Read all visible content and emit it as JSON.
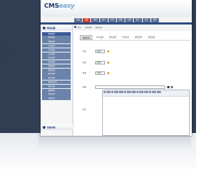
{
  "brand": {
    "name_part1": "CMS",
    "name_part2": "easy",
    "tagline": ""
  },
  "header": {
    "right_text": ""
  },
  "top_nav": {
    "tabs": [
      "首页",
      "设置",
      "内容",
      "用户",
      "订单",
      "模板",
      "功能",
      "推广",
      "日志",
      "插件"
    ],
    "active_index": 1
  },
  "sub_nav": {
    "items": [
      "首页",
      "文章管理",
      "添加内容"
    ]
  },
  "sidebar": {
    "header": "网站设置",
    "items": [
      "网站设置",
      "附件设置",
      "模板设置",
      "分类设置",
      "栏目设置",
      "安全设置",
      "会员设置",
      "邮件设置",
      "数据设置",
      "模板设置",
      "缓存管理",
      "附件管理",
      "数据库设置",
      "图片处理",
      "数据备份",
      "附件设置",
      "系统信息"
    ],
    "active_index": 0,
    "footer": "系统内容"
  },
  "main": {
    "tabs": [
      "基本信息",
      "SEO设置",
      "属性设置",
      "扩展信息",
      "模板选择",
      "高级设置"
    ],
    "active_tab": 0,
    "fields": [
      {
        "label": "栏目",
        "value": "请选择"
      },
      {
        "label": "分类",
        "value": "请选择"
      },
      {
        "label": "置顶",
        "value": "不置顶"
      }
    ],
    "title_label": "标题",
    "content_label": "正文"
  },
  "colors": {
    "accent": "#c63b2e",
    "nav": "#2f4b7e",
    "sidebar_item": "#6b82aa",
    "background": "#2f3c52"
  }
}
